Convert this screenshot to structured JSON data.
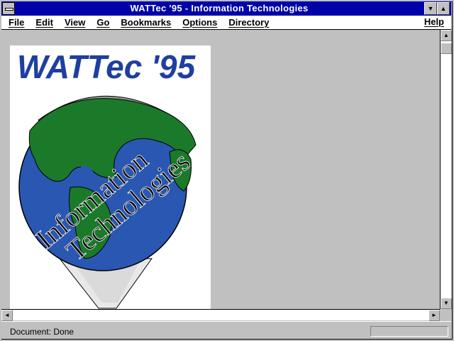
{
  "window": {
    "title": "WATTec '95 - Information Technologies",
    "minimize_glyph": "▼",
    "maximize_glyph": "▲"
  },
  "menu": {
    "items": [
      "File",
      "Edit",
      "View",
      "Go",
      "Bookmarks",
      "Options",
      "Directory"
    ],
    "help": "Help"
  },
  "poster": {
    "logo_text": "WATTec '95",
    "globe_text_line1": "Information",
    "globe_text_line2": "Technologies",
    "colors": {
      "logo": "#1f3fa0",
      "ocean": "#2a57b2",
      "land": "#1b7a2a"
    }
  },
  "scroll": {
    "up": "▲",
    "down": "▼",
    "left": "◄",
    "right": "►"
  },
  "status": {
    "text": "Document: Done"
  }
}
